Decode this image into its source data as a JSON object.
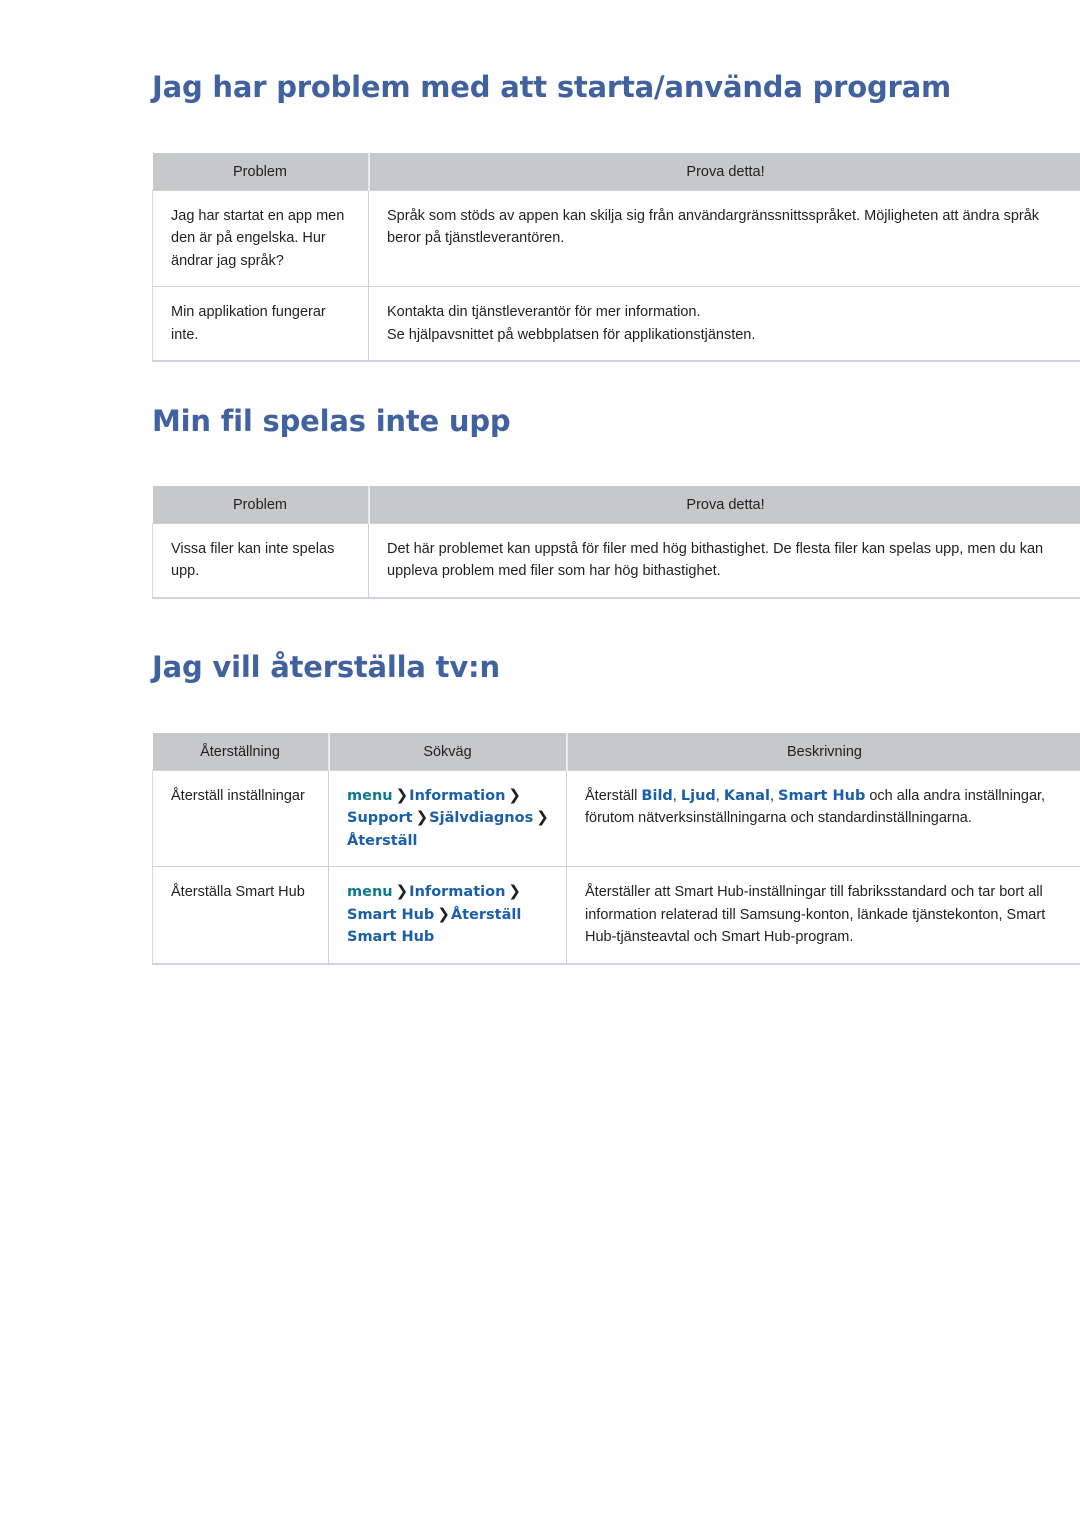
{
  "page": {
    "background_color": "#ffffff",
    "heading_color": "#41619f",
    "table_header_bg": "#c6c8ca",
    "link_blue": "#1b5fa8",
    "menu_teal": "#0d7c8c"
  },
  "sections": [
    {
      "heading": "Jag har problem med att starta/använda program",
      "table": {
        "headers": [
          "Problem",
          "Prova detta!"
        ],
        "rows": [
          {
            "problem": "Jag har startat en app men den är på engelska. Hur ändrar jag språk?",
            "answer": "Språk som stöds av appen kan skilja sig från användargränssnittsspråket. Möjligheten att ändra språk beror på tjänstleverantören."
          },
          {
            "problem": "Min applikation fungerar inte.",
            "answer_line1": "Kontakta din tjänstleverantör för mer information.",
            "answer_line2": "Se hjälpavsnittet på webbplatsen för applikationstjänsten."
          }
        ]
      }
    },
    {
      "heading": "Min fil spelas inte upp",
      "table": {
        "headers": [
          "Problem",
          "Prova detta!"
        ],
        "rows": [
          {
            "problem": "Vissa filer kan inte spelas upp.",
            "answer": "Det här problemet kan uppstå för filer med hög bithastighet. De flesta filer kan spelas upp, men du kan uppleva problem med filer som har hög bithastighet."
          }
        ]
      }
    },
    {
      "heading": "Jag vill återställa tv:n",
      "table": {
        "headers": [
          "Återställning",
          "Sökväg",
          "Beskrivning"
        ],
        "rows": [
          {
            "reset": "Återställ inställningar",
            "path": [
              "menu",
              "Information",
              "Support",
              "Självdiagnos",
              "Återställ"
            ],
            "desc_prefix": "Återställ ",
            "desc_keywords": [
              "Bild",
              "Ljud",
              "Kanal",
              "Smart Hub"
            ],
            "desc_suffix": " och alla andra inställningar, förutom nätverksinställningarna och standardinställningarna."
          },
          {
            "reset": "Återställa Smart Hub",
            "path": [
              "menu",
              "Information",
              "Smart Hub",
              "Återställ Smart Hub"
            ],
            "desc_plain": "Återställer att Smart Hub-inställningar till fabriksstandard och tar bort all information relaterad till Samsung-konton, länkade tjänstekonton, Smart Hub-tjänsteavtal och Smart Hub-program."
          }
        ]
      }
    }
  ],
  "icons": {
    "chevron": "❯"
  }
}
